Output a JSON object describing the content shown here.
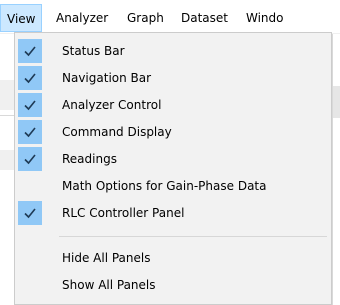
{
  "menubar": {
    "items": [
      {
        "label": "View",
        "active": true
      },
      {
        "label": "Analyzer"
      },
      {
        "label": "Graph"
      },
      {
        "label": "Dataset"
      },
      {
        "label": "Windo"
      }
    ]
  },
  "view_menu": {
    "items": [
      {
        "label": "Status Bar",
        "checked": true
      },
      {
        "label": "Navigation Bar",
        "checked": true
      },
      {
        "label": "Analyzer Control",
        "checked": true
      },
      {
        "label": "Command Display",
        "checked": true
      },
      {
        "label": "Readings",
        "checked": true
      },
      {
        "label": "Math Options for Gain-Phase Data",
        "checked": false
      },
      {
        "label": "RLC Controller Panel",
        "checked": true
      },
      {
        "label": "Hide All Panels",
        "checked": false
      },
      {
        "label": "Show All Panels",
        "checked": false
      }
    ],
    "check_color": "#90c8f6",
    "check_mark": "check-icon"
  }
}
